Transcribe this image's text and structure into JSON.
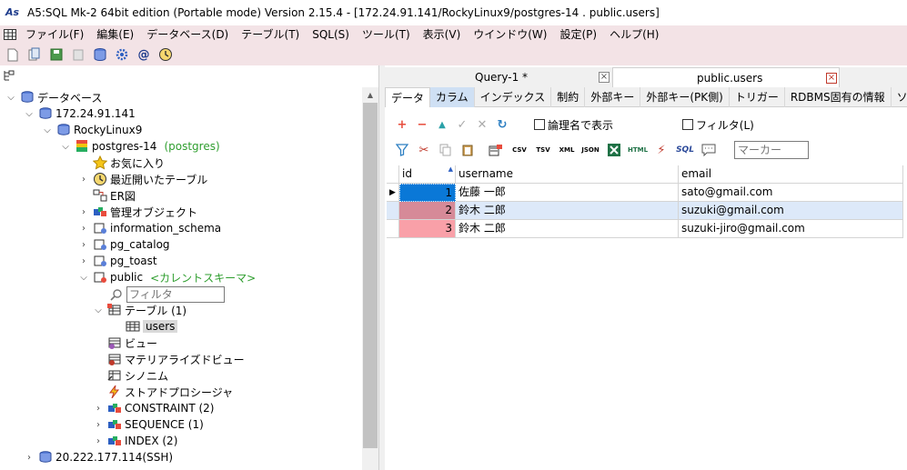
{
  "window": {
    "app_icon": "As",
    "title": "A5:SQL Mk-2 64bit edition (Portable mode) Version 2.15.4 - [172.24.91.141/RockyLinux9/postgres-14 . public.users]"
  },
  "menu": {
    "items": [
      "ファイル(F)",
      "編集(E)",
      "データベース(D)",
      "テーブル(T)",
      "SQL(S)",
      "ツール(T)",
      "表示(V)",
      "ウインドウ(W)",
      "設定(P)",
      "ヘルプ(H)"
    ]
  },
  "toolbar": {
    "at_glyph": "@"
  },
  "tree": {
    "filter_placeholder": "フィルタ",
    "nodes": [
      {
        "label": "データベース"
      },
      {
        "label": "172.24.91.141"
      },
      {
        "label": "RockyLinux9"
      },
      {
        "label": "postgres-14",
        "note": "(postgres)"
      },
      {
        "label": "お気に入り"
      },
      {
        "label": "最近開いたテーブル"
      },
      {
        "label": "ER図"
      },
      {
        "label": "管理オブジェクト"
      },
      {
        "label": "information_schema"
      },
      {
        "label": "pg_catalog"
      },
      {
        "label": "pg_toast"
      },
      {
        "label": "public",
        "note": "<カレントスキーマ>"
      },
      {
        "label": "テーブル (1)"
      },
      {
        "label": "users"
      },
      {
        "label": "ビュー"
      },
      {
        "label": "マテリアライズドビュー"
      },
      {
        "label": "シノニム"
      },
      {
        "label": "ストアドプロシージャ"
      },
      {
        "label": "CONSTRAINT (2)"
      },
      {
        "label": "SEQUENCE (1)"
      },
      {
        "label": "INDEX (2)"
      },
      {
        "label": "20.222.177.114(SSH)"
      }
    ]
  },
  "doc_tabs": [
    {
      "label": "Query-1 *",
      "close": "×"
    },
    {
      "label": "public.users",
      "close": "×"
    }
  ],
  "sub_tabs": [
    "データ",
    "カラム",
    "インデックス",
    "制約",
    "外部キー",
    "外部キー(PK側)",
    "トリガー",
    "RDBMS固有の情報",
    "ソース"
  ],
  "actions": {
    "logical_name_label": "論理名で表示",
    "filter_label": "フィルタ(L)",
    "marker_placeholder": "マーカー",
    "export_icons": [
      "CSV",
      "TSV",
      "XML",
      "JSON",
      "HTML",
      "SQL"
    ]
  },
  "grid": {
    "columns": [
      "id",
      "username",
      "email"
    ],
    "rows": [
      {
        "id": "1",
        "username": "佐藤 一郎",
        "email": "sato@gmail.com"
      },
      {
        "id": "2",
        "username": "鈴木 二郎",
        "email": "suzuki@gmail.com"
      },
      {
        "id": "3",
        "username": "鈴木 二郎",
        "email": "suzuki-jiro@gmail.com"
      }
    ]
  },
  "colors": {
    "menu_bg": "#f3e3e6",
    "row1_id_bg": "#0a78d7",
    "row2_id_bg": "#d68a98",
    "row3_id_bg": "#f9a0a8",
    "row2_bg": "#dde9f9",
    "schema_note": "#2e9e2e",
    "close_red": "#c0392b"
  }
}
